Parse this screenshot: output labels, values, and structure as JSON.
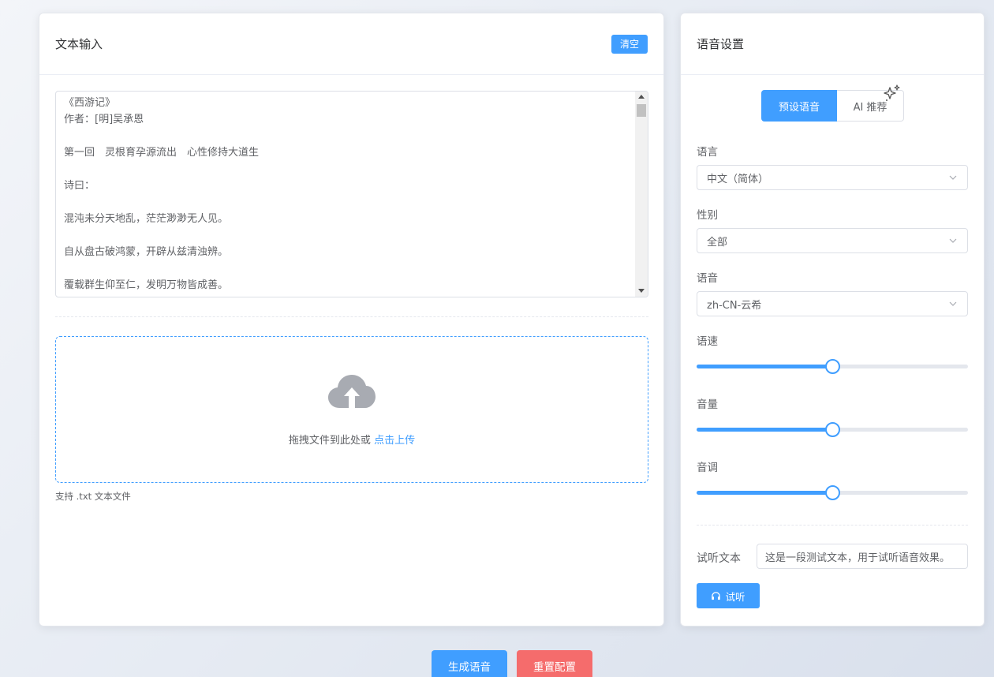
{
  "text_panel": {
    "title": "文本输入",
    "clear_label": "清空",
    "content": "《西游记》\n作者：[明]吴承恩\n\n第一回　灵根育孕源流出　心性修持大道生\n\n诗曰：\n\n混沌未分天地乱，茫茫渺渺无人见。\n\n自从盘古破鸿蒙，开辟从兹清浊辨。\n\n覆载群生仰至仁，发明万物皆成善。",
    "upload_text": "拖拽文件到此处或 ",
    "upload_link": "点击上传",
    "upload_tip": "支持 .txt 文本文件"
  },
  "voice_panel": {
    "title": "语音设置",
    "tabs": [
      {
        "label": "预设语音",
        "active": true
      },
      {
        "label": "AI 推荐",
        "active": false
      }
    ],
    "language": {
      "label": "语言",
      "value": "中文（简体）"
    },
    "gender": {
      "label": "性别",
      "value": "全部"
    },
    "voice": {
      "label": "语音",
      "value": "zh-CN-云希"
    },
    "rate": {
      "label": "语速",
      "level": 0.5
    },
    "volume": {
      "label": "音量",
      "level": 0.5
    },
    "pitch": {
      "label": "音调",
      "level": 0.5
    },
    "preview_label": "试听文本",
    "preview_value": "这是一段测试文本，用于试听语音效果。",
    "listen_label": "试听"
  },
  "actions": {
    "generate_label": "生成语音",
    "reset_label": "重置配置"
  },
  "colors": {
    "primary": "#409eff",
    "danger": "#f56c6c"
  }
}
